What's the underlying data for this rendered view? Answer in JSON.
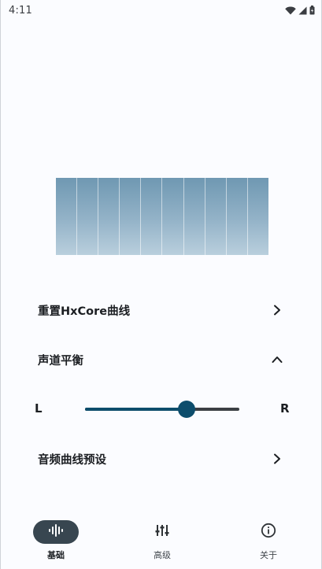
{
  "status_bar": {
    "time": "4:11",
    "icons": [
      "wifi-icon",
      "cell-signal-icon",
      "battery-icon"
    ]
  },
  "eq_graph": {
    "band_count": 10
  },
  "settings": {
    "reset_curve_label": "重置HxCore曲线",
    "balance_label": "声道平衡",
    "balance_left": "L",
    "balance_right": "R",
    "balance_value": 0.66,
    "presets_label": "音频曲线预设"
  },
  "nav": {
    "items": [
      {
        "label": "基础",
        "icon": "waveform-icon",
        "active": true
      },
      {
        "label": "高级",
        "icon": "sliders-icon",
        "active": false
      },
      {
        "label": "关于",
        "icon": "info-icon",
        "active": false
      }
    ]
  },
  "colors": {
    "accent": "#0d4d6c",
    "background": "#fbfcff",
    "nav_active_pill": "#384650",
    "eq_top": "#6f98b2",
    "eq_bottom": "#b9cfdd"
  }
}
